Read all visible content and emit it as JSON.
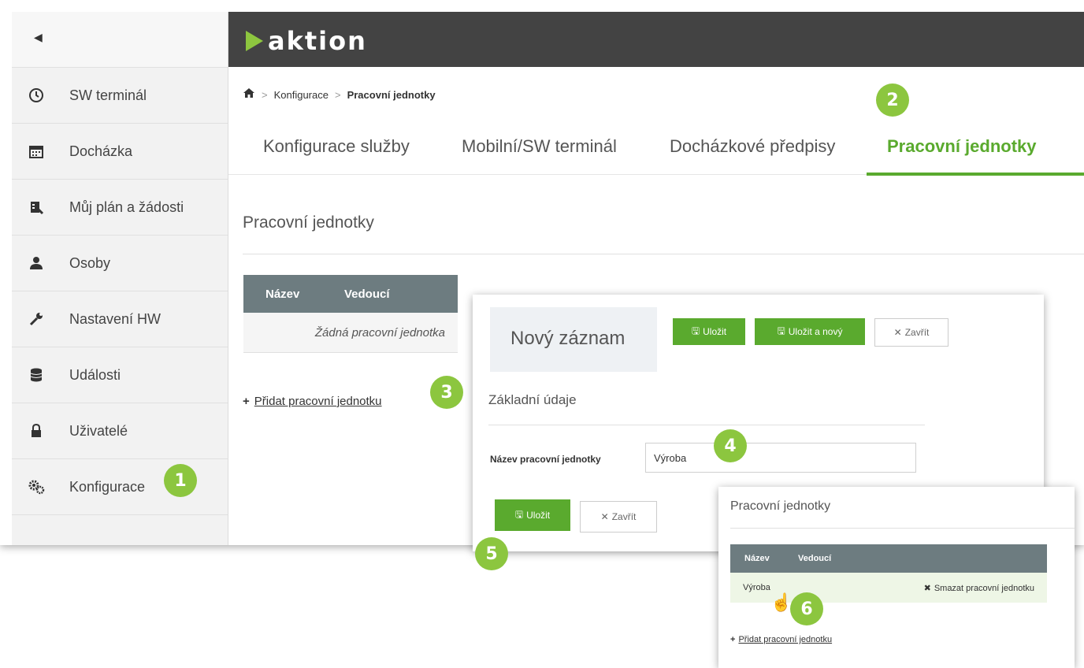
{
  "sidebar": {
    "back_icon": "chevron-left-icon",
    "items": [
      {
        "label": "SW terminál",
        "icon": "clock-icon"
      },
      {
        "label": "Docházka",
        "icon": "calendar-icon"
      },
      {
        "label": "Můj plán a žádosti",
        "icon": "plan-icon"
      },
      {
        "label": "Osoby",
        "icon": "person-icon"
      },
      {
        "label": "Nastavení HW",
        "icon": "wrench-icon"
      },
      {
        "label": "Události",
        "icon": "database-icon"
      },
      {
        "label": "Uživatelé",
        "icon": "lock-icon"
      },
      {
        "label": "Konfigurace",
        "icon": "gears-icon"
      }
    ]
  },
  "header": {
    "logo_text": "aktion",
    "logo_color": "#8dc63f",
    "bar_color": "#434343"
  },
  "breadcrumb": {
    "home_icon": "home-icon",
    "items": [
      "Konfigurace",
      "Pracovní jednotky"
    ]
  },
  "tabs": [
    {
      "label": "Konfigurace služby",
      "active": false
    },
    {
      "label": "Mobilní/SW terminál",
      "active": false
    },
    {
      "label": "Docházkové předpisy",
      "active": false
    },
    {
      "label": "Pracovní jednotky",
      "active": true
    }
  ],
  "accent_color": "#5aaa2e",
  "main": {
    "section_title": "Pracovní jednotky",
    "table": {
      "columns": [
        "Název",
        "Vedoucí"
      ],
      "empty_text": "Žádná pracovní jednotka"
    },
    "add_link": "Přidat pracovní jednotku"
  },
  "new_record": {
    "title": "Nový záznam",
    "save_label": "Uložit",
    "save_new_label": "Uložit a nový",
    "close_label": "Zavřít",
    "section": "Základní údaje",
    "field_label": "Název pracovní jednotky",
    "field_value": "Výroba",
    "bottom_save_label": "Uložit",
    "bottom_close_label": "Zavřít"
  },
  "result_panel": {
    "title": "Pracovní jednotky",
    "columns": [
      "Název",
      "Vedoucí"
    ],
    "rows": [
      {
        "name": "Výroba",
        "action": "Smazat pracovní jednotku"
      }
    ],
    "add_link": "Přidat pracovní jednotku"
  },
  "badges": [
    "1",
    "2",
    "3",
    "4",
    "5",
    "6"
  ]
}
